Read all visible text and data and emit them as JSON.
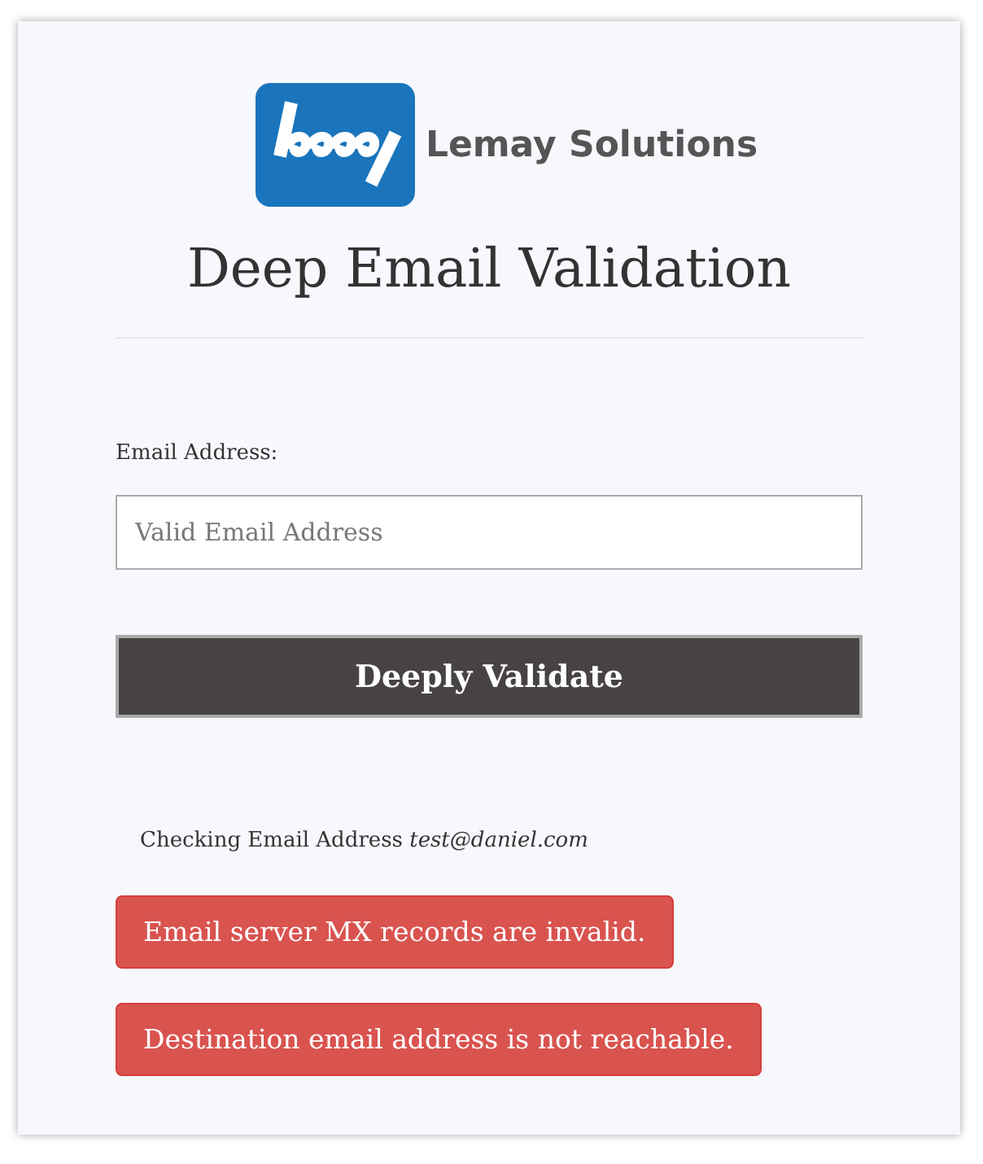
{
  "logo": {
    "name": "Lemay Solutions"
  },
  "title": "Deep Email Validation",
  "form": {
    "label": "Email Address:",
    "input": {
      "placeholder": "Valid Email Address"
    },
    "button": "Deeply Validate"
  },
  "status": "Checking Email Address *test@daniel.com*",
  "alerts": [
    {
      "kind": "danger",
      "text": "Email server MX records are invalid."
    },
    {
      "kind": "danger",
      "text": "Destination email address is not reachable."
    }
  ]
}
